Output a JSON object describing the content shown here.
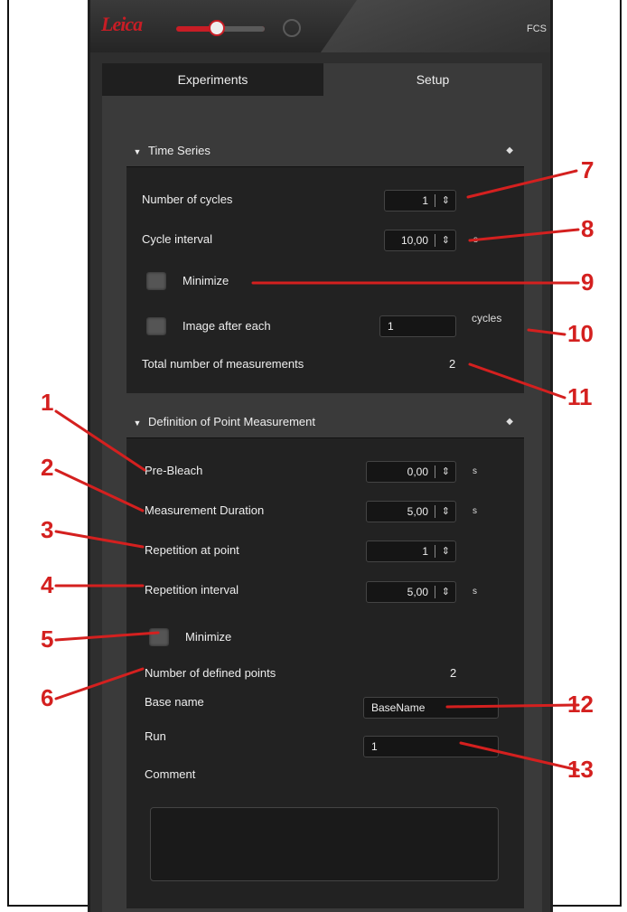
{
  "app": {
    "logo": "Leica",
    "title": "FCS"
  },
  "tabs": [
    {
      "label": "Experiments"
    },
    {
      "label": "Setup"
    }
  ],
  "time_series": {
    "header": "Time Series",
    "number_of_cycles": {
      "label": "Number of cycles",
      "value": "1"
    },
    "cycle_interval": {
      "label": "Cycle interval",
      "value": "10,00",
      "unit": "s"
    },
    "minimize": {
      "label": "Minimize"
    },
    "image_after_each": {
      "label": "Image after each",
      "value": "1",
      "unit": "cycles"
    },
    "total_measurements": {
      "label": "Total number of measurements",
      "value": "2"
    }
  },
  "point_measurement": {
    "header": "Definition of Point Measurement",
    "pre_bleach": {
      "label": "Pre-Bleach",
      "value": "0,00",
      "unit": "s"
    },
    "measurement_duration": {
      "label": "Measurement Duration",
      "value": "5,00",
      "unit": "s"
    },
    "repetition_at_point": {
      "label": "Repetition at point",
      "value": "1"
    },
    "repetition_interval": {
      "label": "Repetition interval",
      "value": "5,00",
      "unit": "s"
    },
    "minimize": {
      "label": "Minimize"
    },
    "defined_points": {
      "label": "Number of defined points",
      "value": "2"
    },
    "base_name": {
      "label": "Base name",
      "value": "BaseName"
    },
    "run": {
      "label": "Run",
      "value": "1"
    },
    "comment": {
      "label": "Comment",
      "value": ""
    }
  },
  "callouts": {
    "c1": "1",
    "c2": "2",
    "c3": "3",
    "c4": "4",
    "c5": "5",
    "c6": "6",
    "c7": "7",
    "c8": "8",
    "c9": "9",
    "c10": "10",
    "c11": "11",
    "c12": "12",
    "c13": "13"
  },
  "colors": {
    "callout_red": "#d4201f",
    "panel_bg": "#2e2e2e",
    "brand_red": "#c81d25"
  }
}
